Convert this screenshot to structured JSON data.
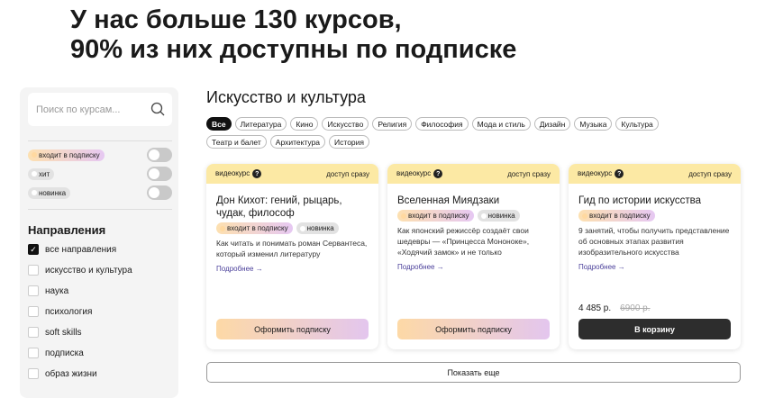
{
  "headline": [
    "У нас больше 130 курсов,",
    "90% из них доступны по подписке"
  ],
  "sidebar": {
    "search_placeholder": "Поиск по курсам...",
    "filters": [
      {
        "label": "входит в подписку"
      },
      {
        "label": "хит"
      },
      {
        "label": "новинка"
      }
    ],
    "directions_title": "Направления",
    "directions": [
      {
        "label": "все направления",
        "checked": true
      },
      {
        "label": "искусство и культура"
      },
      {
        "label": "наука"
      },
      {
        "label": "психология"
      },
      {
        "label": "soft skills"
      },
      {
        "label": "подписка"
      },
      {
        "label": "образ жизни"
      }
    ]
  },
  "main": {
    "title": "Искусство и культура",
    "chips": [
      "Все",
      "Литература",
      "Кино",
      "Искусство",
      "Религия",
      "Философия",
      "Мода и стиль",
      "Дизайн",
      "Музыка",
      "Культура",
      "Театр и балет",
      "Архитектура",
      "История"
    ],
    "cards": [
      {
        "type": "видеокурс",
        "access": "доступ сразу",
        "title": "Дон Кихот: гений, рыцарь, чудак, философ",
        "tags": [
          "входит в подписку",
          "новинка"
        ],
        "desc": "Как читать и понимать роман Сервантеса, который изменил литературу",
        "more": "Подробнее →",
        "button": "Оформить подписку"
      },
      {
        "type": "видеокурс",
        "access": "доступ сразу",
        "title": "Вселенная Миядзаки",
        "tags": [
          "входит в подписку",
          "новинка"
        ],
        "desc": "Как японский режиссёр создаёт свои шедевры — «Принцесса Мононоке», «Ходячий замок» и не только",
        "more": "Подробнее →",
        "button": "Оформить подписку"
      },
      {
        "type": "видеокурс",
        "access": "доступ сразу",
        "title": "Гид по истории искусства",
        "tags": [
          "входит в подписку"
        ],
        "desc": "9 занятий, чтобы получить представление об основных этапах развития изобразительного искусства",
        "more": "Подробнее →",
        "price": "4 485 р.",
        "old_price": "6900 р.",
        "button": "В корзину"
      }
    ],
    "show_more": "Показать еще"
  }
}
